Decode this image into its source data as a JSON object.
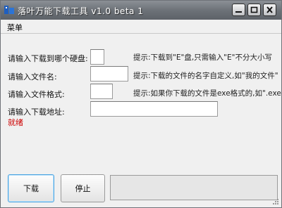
{
  "window": {
    "title": "落叶万能下载工具 v1.0 beta 1"
  },
  "menu": {
    "items": [
      {
        "label": "菜单"
      }
    ]
  },
  "form": {
    "drive": {
      "label": "请输入下载到哪个硬盘:",
      "value": "",
      "hint": "提示:下载到\"E\"盘,只需输入\"E\"不分大小写"
    },
    "filename": {
      "label": "请输入文件名:",
      "value": "",
      "hint": "提示:下载的文件的名字自定义,如\"我的文件\""
    },
    "format": {
      "label": "请输入文件格式:",
      "value": "",
      "hint": "提示:如果你下载的文件是exe格式的,如\".exe\""
    },
    "url": {
      "label": "请输入下载地址:",
      "value": ""
    }
  },
  "status": {
    "text": "就绪",
    "color": "#cc0000"
  },
  "buttons": {
    "download": "下载",
    "stop": "停止"
  },
  "progress": {
    "value": 0
  },
  "colors": {
    "titlebar": "#6d7278",
    "accent": "#4aa3e0",
    "icon_blue": "#1f5fbf"
  }
}
